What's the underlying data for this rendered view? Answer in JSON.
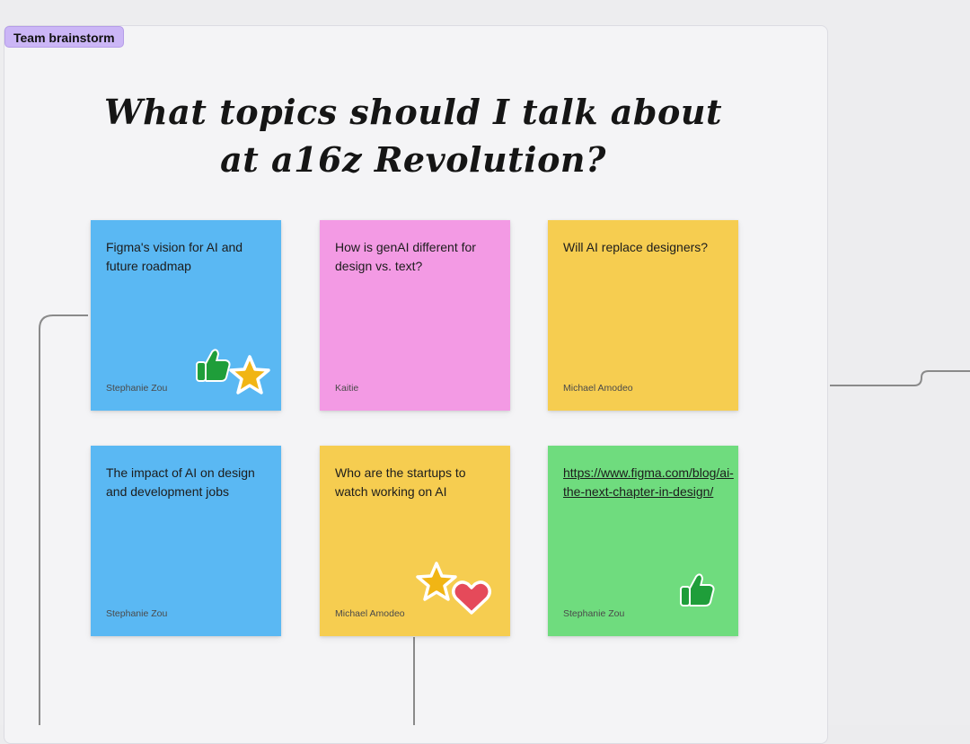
{
  "board": {
    "section_label": "Team brainstorm",
    "title_line1": "What topics should I talk about",
    "title_line2": "at a16z Revolution?"
  },
  "stickies": [
    {
      "text": "Figma's vision for AI and future roadmap",
      "author": "Stephanie Zou",
      "color": "#5ab8f3",
      "stickers": [
        "thumbs-up-icon",
        "star-icon"
      ]
    },
    {
      "text": "How is genAI different for design vs. text?",
      "author": "Kaitie",
      "color": "#f39ae4",
      "stickers": []
    },
    {
      "text": "Will AI replace designers?",
      "author": "Michael Amodeo",
      "color": "#f6cd50",
      "stickers": []
    },
    {
      "text": "The impact of AI on design and development jobs",
      "author": "Stephanie Zou",
      "color": "#5ab8f3",
      "stickers": []
    },
    {
      "text": "Who are the startups to watch working on AI",
      "author": "Michael Amodeo",
      "color": "#f6cd50",
      "stickers": [
        "star-icon",
        "heart-icon"
      ]
    },
    {
      "text": "https://www.figma.com/blog/ai-the-next-chapter-in-design/",
      "author": "Stephanie Zou",
      "color": "#6fdc7e",
      "stickers": [
        "thumbs-up-icon"
      ]
    }
  ]
}
